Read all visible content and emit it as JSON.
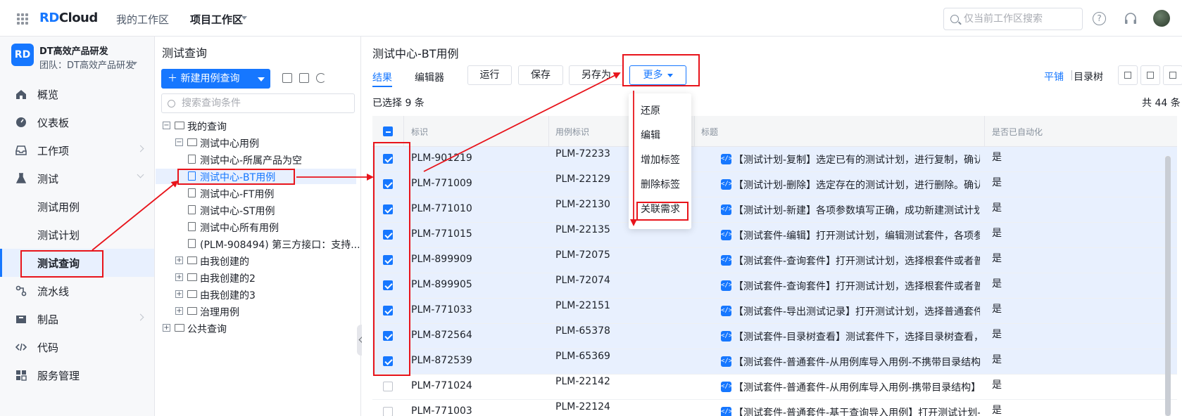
{
  "header": {
    "logo_rd": "RD",
    "logo_cloud": "Cloud",
    "nav_my_workspace": "我的工作区",
    "nav_project_workspace": "项目工作区",
    "search_placeholder": "仅当前工作区搜索"
  },
  "sidebar": {
    "team_logo": "RD",
    "team_name": "DT高效产品研发",
    "team_sub": "团队：DT高效产品研发",
    "items": [
      {
        "label": "概览"
      },
      {
        "label": "仪表板"
      },
      {
        "label": "工作项"
      },
      {
        "label": "测试"
      },
      {
        "label": "测试用例"
      },
      {
        "label": "测试计划"
      },
      {
        "label": "测试查询"
      },
      {
        "label": "流水线"
      },
      {
        "label": "制品"
      },
      {
        "label": "代码"
      },
      {
        "label": "服务管理"
      }
    ]
  },
  "query_panel": {
    "title": "测试查询",
    "new_button": "＋ 新建用例查询",
    "search_placeholder": "搜索查询条件",
    "tree": [
      {
        "label": "我的查询"
      },
      {
        "label": "测试中心用例"
      },
      {
        "label": "测试中心-所属产品为空"
      },
      {
        "label": "测试中心-BT用例"
      },
      {
        "label": "测试中心-FT用例"
      },
      {
        "label": "测试中心-ST用例"
      },
      {
        "label": "测试中心所有用例"
      },
      {
        "label": "(PLM-908494) 第三方接口：支持..."
      },
      {
        "label": "由我创建的"
      },
      {
        "label": "由我创建的2"
      },
      {
        "label": "由我创建的3"
      },
      {
        "label": "治理用例"
      },
      {
        "label": "公共查询"
      }
    ]
  },
  "main": {
    "title": "测试中心-BT用例",
    "tabs": [
      "结果",
      "编辑器"
    ],
    "buttons": {
      "run": "运行",
      "save": "保存",
      "save_as": "另存为",
      "more": "更多"
    },
    "view_flat": "平铺",
    "view_sep": "|",
    "view_tree": "目录树",
    "selected_count": "已选择 9 条",
    "total_count": "共 44 条",
    "columns": [
      "标识",
      "用例标识",
      "标题",
      "是否已自动化"
    ],
    "rows": [
      {
        "id": "PLM-901219",
        "case_id": "PLM-72233",
        "title": "【测试计划-复制】选定已有的测试计划，进行复制，确认...",
        "auto": "是",
        "checked": true
      },
      {
        "id": "PLM-771009",
        "case_id": "PLM-22129",
        "title": "【测试计划-删除】选定存在的测试计划，进行删除。确认...",
        "auto": "是",
        "checked": true
      },
      {
        "id": "PLM-771010",
        "case_id": "PLM-22130",
        "title": "【测试计划-新建】各项参数填写正确，成功新建测试计划。",
        "auto": "是",
        "checked": true
      },
      {
        "id": "PLM-771015",
        "case_id": "PLM-22135",
        "title": "【测试套件-编辑】打开测试计划，编辑测试套件，各项参...",
        "auto": "是",
        "checked": true
      },
      {
        "id": "PLM-899909",
        "case_id": "PLM-72075",
        "title": "【测试套件-查询套件】打开测试计划，选择根套件或者普...",
        "auto": "是",
        "checked": true
      },
      {
        "id": "PLM-899905",
        "case_id": "PLM-72074",
        "title": "【测试套件-查询套件】打开测试计划，选择根套件或者普...",
        "auto": "是",
        "checked": true
      },
      {
        "id": "PLM-771033",
        "case_id": "PLM-22151",
        "title": "【测试套件-导出测试记录】打开测试计划，选择普通套件...",
        "auto": "是",
        "checked": true
      },
      {
        "id": "PLM-872564",
        "case_id": "PLM-65378",
        "title": "【测试套件-目录树查看】测试套件下，选择目录树查看，...",
        "auto": "是",
        "checked": true
      },
      {
        "id": "PLM-872539",
        "case_id": "PLM-65369",
        "title": "【测试套件-普通套件-从用例库导入用例-不携带目录结构...",
        "auto": "是",
        "checked": true
      },
      {
        "id": "PLM-771024",
        "case_id": "PLM-22142",
        "title": "【测试套件-普通套件-从用例库导入用例-携带目录结构】...",
        "auto": "是",
        "checked": false
      },
      {
        "id": "PLM-771003",
        "case_id": "PLM-22124",
        "title": "【测试套件-普通套件-基于查询导入用例】打开测试计划-...",
        "auto": "是",
        "checked": false
      }
    ],
    "more_menu": [
      "还原",
      "编辑",
      "增加标签",
      "删除标签",
      "关联需求"
    ]
  },
  "colors": {
    "accent": "#1677ff",
    "annotation": "#e8141b"
  }
}
